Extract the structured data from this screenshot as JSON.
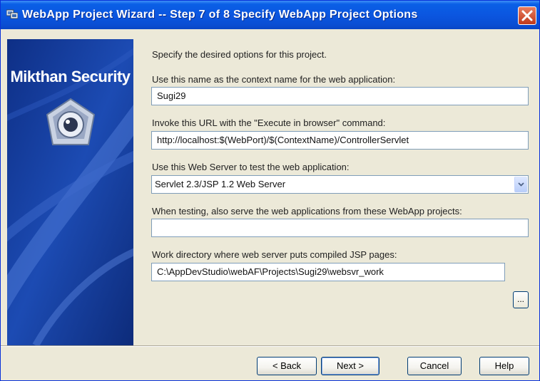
{
  "window": {
    "title": "WebApp Project Wizard  -- Step 7 of 8  Specify WebApp Project Options"
  },
  "side_panel": {
    "brand": "Mikthan Security"
  },
  "main": {
    "intro": "Specify the desired options for this project.",
    "context": {
      "label": "Use this name as the context name for the web application:",
      "value": "Sugi29"
    },
    "url": {
      "label": "Invoke this URL with the \"Execute in browser\" command:",
      "value": "http://localhost:$(WebPort)/$(ContextName)/ControllerServlet"
    },
    "server": {
      "label": "Use this Web Server to test the web application:",
      "selected": "Servlet 2.3/JSP 1.2 Web Server"
    },
    "projects": {
      "label": "When testing, also serve the web applications from these WebApp projects:",
      "value": ""
    },
    "workdir": {
      "label": "Work directory where web server puts compiled JSP pages:",
      "value": "C:\\AppDevStudio\\webAF\\Projects\\Sugi29\\websvr_work",
      "browse_label": "..."
    }
  },
  "buttons": {
    "back": "< Back",
    "next": "Next >",
    "cancel": "Cancel",
    "help": "Help"
  },
  "colors": {
    "titlebar": "#0b56e0",
    "side_panel": "#143c98",
    "dialog_bg": "#ece9d8",
    "close": "#c0391b"
  }
}
